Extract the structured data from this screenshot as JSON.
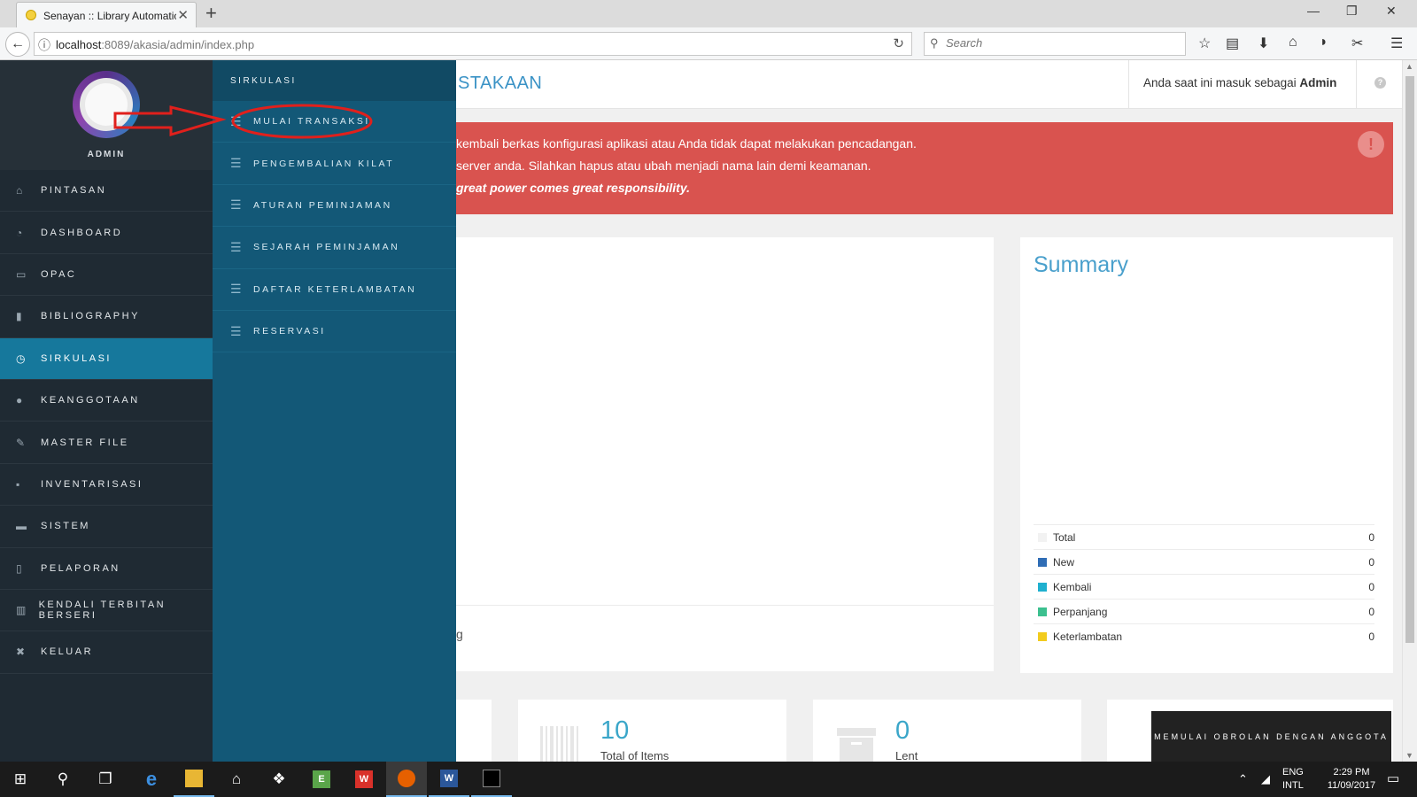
{
  "browser": {
    "tab_title": "Senayan :: Library Automatic",
    "url_host": "localhost",
    "url_rest": ":8089/akasia/admin/index.php",
    "search_placeholder": "Search"
  },
  "sidebar": {
    "profile_name": "ADMIN",
    "items": [
      {
        "label": "PINTASAN",
        "icon": "home-icon"
      },
      {
        "label": "DASHBOARD",
        "icon": "dashboard-icon"
      },
      {
        "label": "OPAC",
        "icon": "monitor-icon"
      },
      {
        "label": "BIBLIOGRAPHY",
        "icon": "bookmark-icon"
      },
      {
        "label": "SIRKULASI",
        "icon": "clock-icon",
        "active": true
      },
      {
        "label": "KEANGGOTAAN",
        "icon": "user-icon"
      },
      {
        "label": "MASTER FILE",
        "icon": "pencil-icon"
      },
      {
        "label": "INVENTARISASI",
        "icon": "briefcase-icon"
      },
      {
        "label": "SISTEM",
        "icon": "keyboard-icon"
      },
      {
        "label": "PELAPORAN",
        "icon": "document-icon"
      },
      {
        "label": "KENDALI TERBITAN BERSERI",
        "icon": "barcode-icon"
      },
      {
        "label": "KELUAR",
        "icon": "close-icon"
      }
    ]
  },
  "submenu": {
    "header": "SIRKULASI",
    "items": [
      "MULAI TRANSAKSI",
      "PENGEMBALIAN KILAT",
      "ATURAN PEMINJAMAN",
      "SEJARAH PEMINJAMAN",
      "DAFTAR KETERLAMBATAN",
      "RESERVASI"
    ]
  },
  "header": {
    "title_fragment": "STAKAAN",
    "login_prefix": "Anda saat ini masuk sebagai ",
    "login_user": "Admin"
  },
  "alert": {
    "line1": "kembali berkas konfigurasi aplikasi atau Anda tidak dapat melakukan pencadangan.",
    "line2": "server anda. Silahkan hapus atau ubah menjadi nama lain demi keamanan.",
    "line3": "great power comes great responsibility.",
    "icon": "exclamation-icon"
  },
  "panel_left": {
    "fragment": "g"
  },
  "summary": {
    "title": "Summary",
    "rows": [
      {
        "label": "Total",
        "value": "0",
        "color": "#f2f2f2"
      },
      {
        "label": "New",
        "value": "0",
        "color": "#2f6db5"
      },
      {
        "label": "Kembali",
        "value": "0",
        "color": "#1fb0cf"
      },
      {
        "label": "Perpanjang",
        "value": "0",
        "color": "#3cc08f"
      },
      {
        "label": "Keterlambatan",
        "value": "0",
        "color": "#f2cb1d"
      }
    ]
  },
  "cards": [
    {
      "number": "10",
      "label": "Total of Items"
    },
    {
      "number": "0",
      "label": "Lent"
    }
  ],
  "chat_button": "MEMULAI OBROLAN DENGAN ANGGOTA",
  "taskbar": {
    "lang1": "ENG",
    "lang2": "INTL",
    "time": "2:29 PM",
    "date": "11/09/2017"
  }
}
